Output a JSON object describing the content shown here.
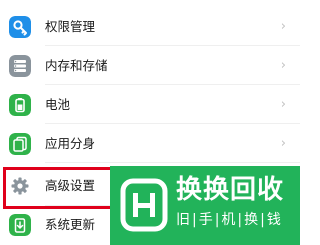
{
  "settings": {
    "items": [
      {
        "label": "权限管理",
        "icon": "key-icon",
        "color": "#1f8fe8"
      },
      {
        "label": "内存和存储",
        "icon": "storage-icon",
        "color": "#8a949c"
      },
      {
        "label": "电池",
        "icon": "battery-icon",
        "color": "#2fb24a"
      },
      {
        "label": "应用分身",
        "icon": "app-twin-icon",
        "color": "#2fb24a"
      },
      {
        "label": "高级设置",
        "icon": "gear-icon",
        "color": "#8a949c"
      },
      {
        "label": "系统更新",
        "icon": "update-icon",
        "color": "#2fb24a"
      }
    ],
    "chevron": "›"
  },
  "highlight": {
    "color": "#e0001b"
  },
  "watermark": {
    "title": "换换回收",
    "subtitle": "旧|手|机|换|钱",
    "background": "#22b35a"
  }
}
